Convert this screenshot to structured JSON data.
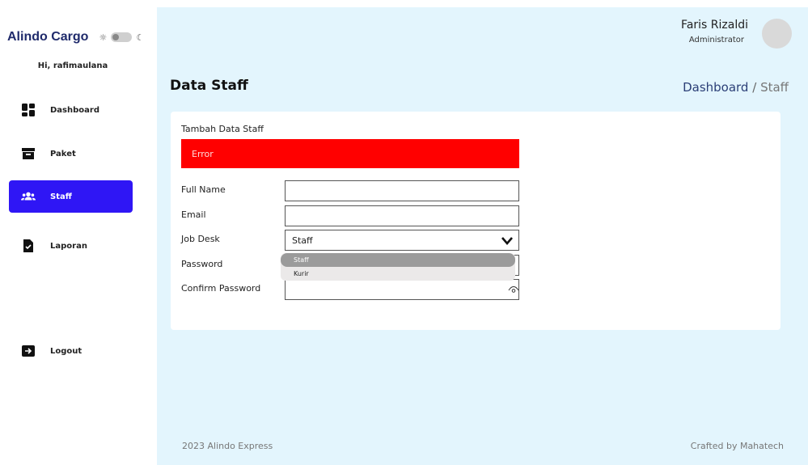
{
  "sidebar": {
    "brand": "Alindo Cargo",
    "greeting": "Hi, rafimaulana",
    "items": [
      {
        "label": "Dashboard",
        "icon": "grid-icon"
      },
      {
        "label": "Paket",
        "icon": "archive-box-icon"
      },
      {
        "label": "Staff",
        "icon": "users-icon",
        "active": true
      },
      {
        "label": "Laporan",
        "icon": "document-check-icon"
      },
      {
        "label": "Logout",
        "icon": "logout-icon"
      }
    ]
  },
  "header": {
    "user_name": "Faris Rizaldi",
    "user_role": "Administrator"
  },
  "page": {
    "title": "Data Staff",
    "breadcrumb_link": "Dashboard",
    "breadcrumb_sep": " / ",
    "breadcrumb_current": "Staff"
  },
  "form": {
    "title": "Tambah Data Staff",
    "error": "Error",
    "full_name_label": "Full Name",
    "email_label": "Email",
    "job_desk_label": "Job Desk",
    "job_desk_value": "Staff",
    "password_label": "Password",
    "confirm_password_label": "Confirm Password",
    "job_desk_options": [
      "Staff",
      "Kurir"
    ]
  },
  "footer": {
    "left": "2023 Alindo Express",
    "right": "Crafted by Mahatech"
  },
  "colors": {
    "active_nav": "#2f16f5",
    "main_bg": "#e3f5fd",
    "error_bg": "#ff0000",
    "brand": "#1f2a6b"
  }
}
